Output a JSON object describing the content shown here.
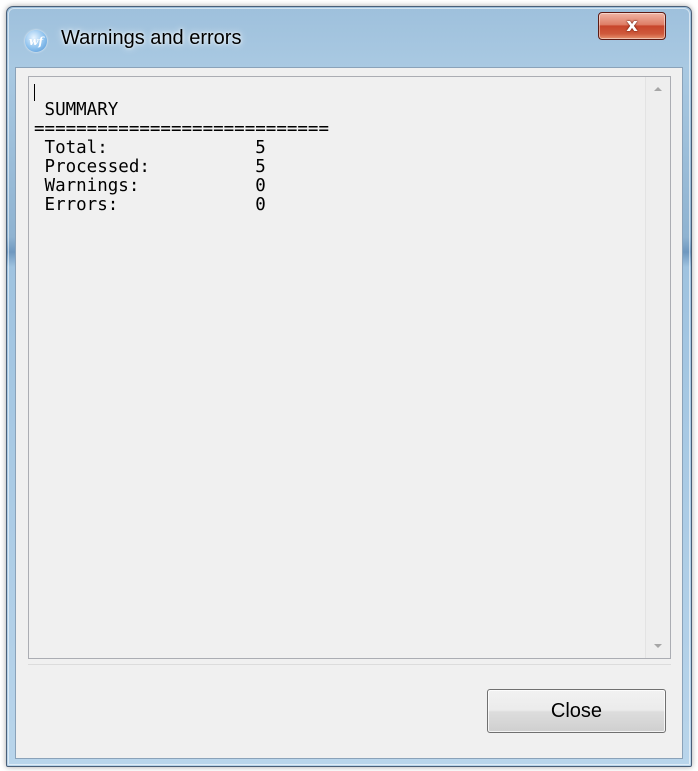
{
  "window": {
    "title": "Warnings and errors",
    "app_icon_glyph": "wf",
    "close_glyph": "x"
  },
  "log": {
    "lines": [
      "",
      " SUMMARY",
      "============================",
      " Total:              5",
      " Processed:          5",
      " Warnings:           0",
      " Errors:             0"
    ]
  },
  "footer": {
    "close_label": "Close"
  },
  "icons": {
    "app": "app-logo-icon",
    "window_close": "close-icon",
    "scroll_up": "scroll-up-arrow-icon",
    "scroll_down": "scroll-down-arrow-icon"
  },
  "colors": {
    "titlebar": "#a9c9e2",
    "close_button": "#c7452c",
    "client_background": "#f0f0f0"
  }
}
